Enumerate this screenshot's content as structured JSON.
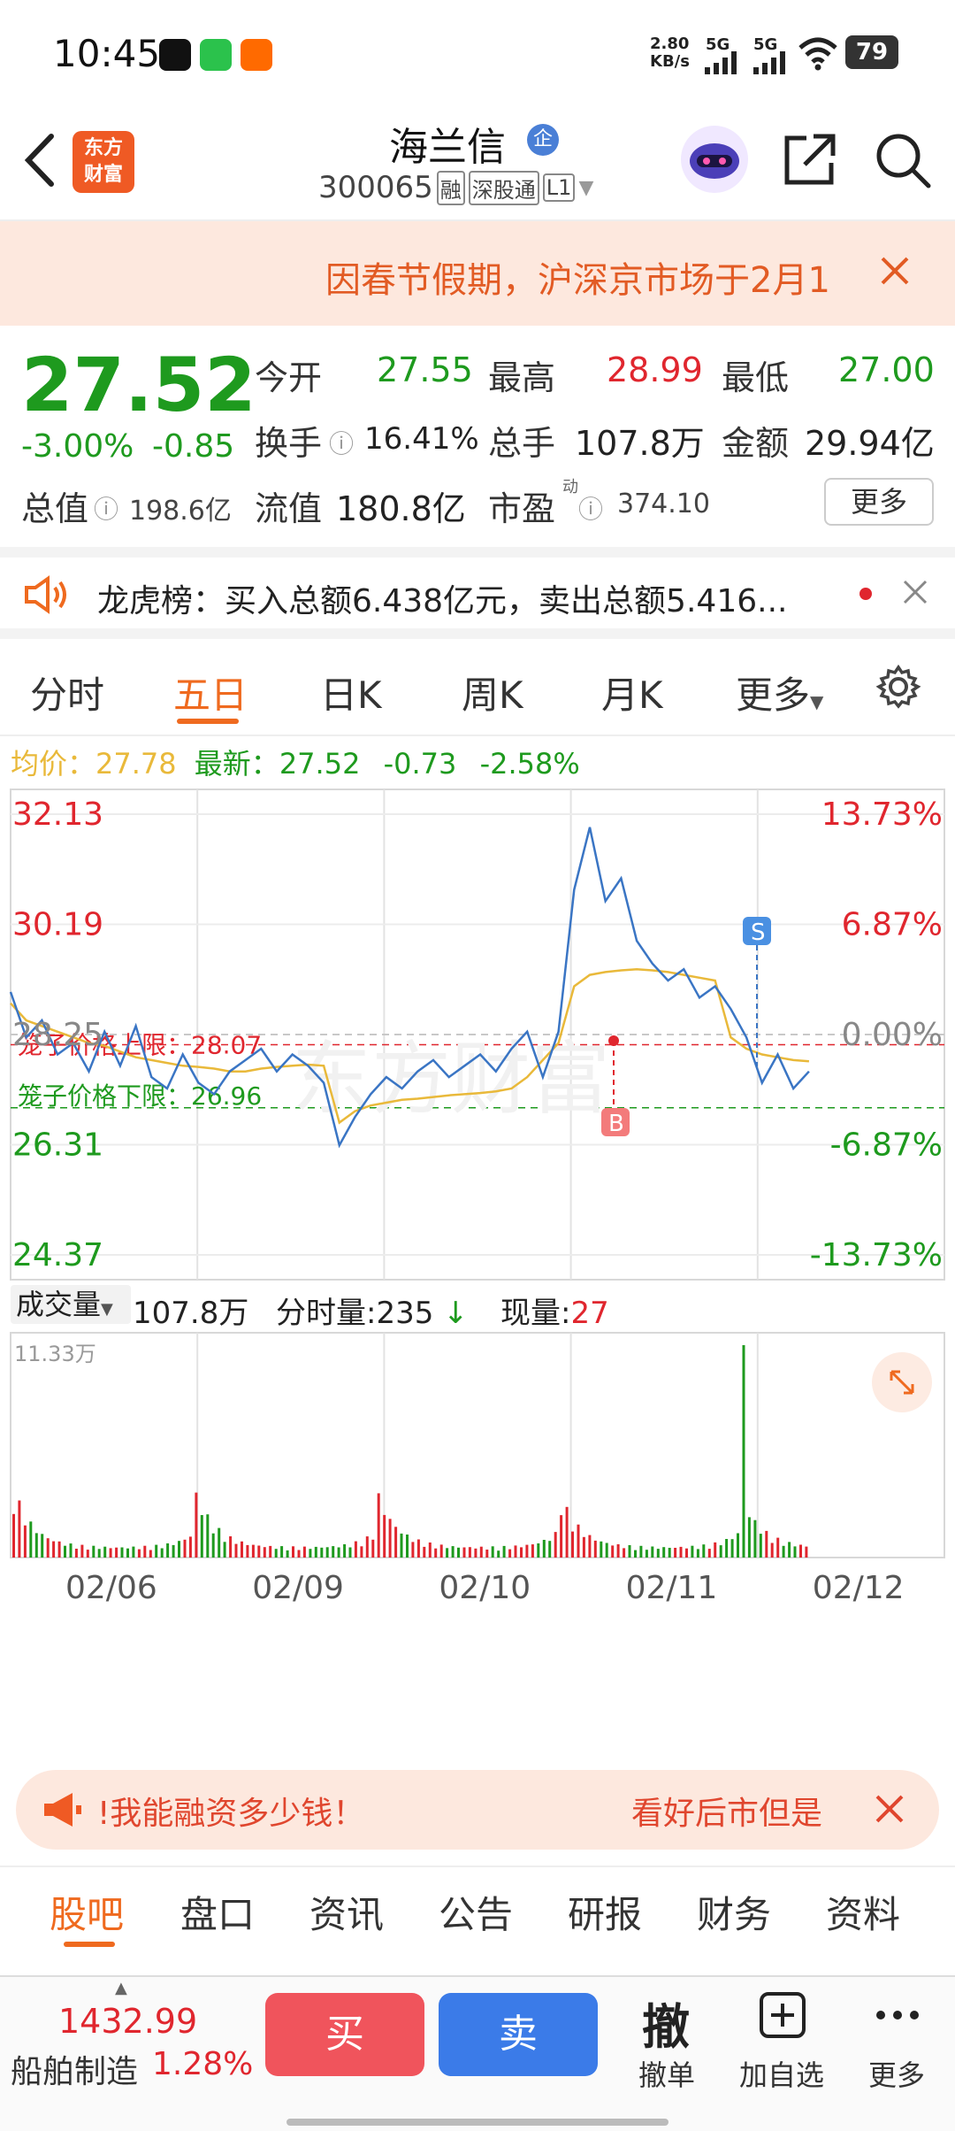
{
  "status_bar": {
    "time": "10:45",
    "net_speed": "2.80",
    "net_unit": "KB/s",
    "sig1": "5G",
    "sig2": "5G",
    "battery": "79"
  },
  "header": {
    "app_logo_line1": "东方",
    "app_logo_line2": "财富",
    "stock_name": "海兰信",
    "stock_badge": "企",
    "stock_code": "300065",
    "tag_margin": "融",
    "tag_connect": "深股通",
    "tag_level": "L1"
  },
  "notice": {
    "text": "因春节假期，沪深京市场于2月1"
  },
  "quote": {
    "price": "27.52",
    "change_pct": "-3.00%",
    "change_amt": "-0.85",
    "open_label": "今开",
    "open": "27.55",
    "high_label": "最高",
    "high": "28.99",
    "low_label": "最低",
    "low": "27.00",
    "turnover_label": "换手",
    "turnover": "16.41%",
    "volume_label": "总手",
    "volume": "107.8万",
    "amount_label": "金额",
    "amount": "29.94亿",
    "mktcap_label": "总值",
    "mktcap": "198.6亿",
    "float_label": "流值",
    "float": "180.8亿",
    "pe_label": "市盈",
    "pe_sup": "动",
    "pe": "374.10",
    "more_button": "更多"
  },
  "lhb": {
    "text": "龙虎榜：买入总额6.438亿元，卖出总额5.416..."
  },
  "chart_tabs": {
    "items": [
      "分时",
      "五日",
      "日K",
      "周K",
      "月K",
      "更多"
    ],
    "active": "五日"
  },
  "chart": {
    "avg_label": "均价：",
    "avg_value": "27.78",
    "latest_label": "最新：",
    "latest_value": "27.52",
    "latest_chg": "-0.73",
    "latest_pct": "-2.58%",
    "cage_upper": "笼子价格上限：28.07",
    "cage_lower": "笼子价格下限：26.96",
    "watermark": "东方财富",
    "marker_s": "S",
    "marker_b": "B",
    "vol_selector": "成交量",
    "vol_total": "107.8万",
    "vol_tick_label": "分时量:235",
    "vol_now_label": "现量:",
    "vol_now": "27",
    "vol_max": "11.33万",
    "colors": {
      "price_line": "#3a75c4",
      "avg_line": "#e9b93a",
      "up": "#e0262e",
      "down": "#1e9a1e"
    }
  },
  "chart_data": {
    "type": "line",
    "x_labels": [
      "02/06",
      "02/09",
      "02/10",
      "02/11",
      "02/12"
    ],
    "y_left_ticks": [
      "32.13",
      "30.19",
      "28.25",
      "26.31",
      "24.37"
    ],
    "y_right_ticks": [
      "13.73%",
      "6.87%",
      "0.00%",
      "-6.87%",
      "-13.73%"
    ],
    "ylim": [
      24.37,
      32.13
    ],
    "series": [
      {
        "values": [
          29.0,
          28.2,
          28.5,
          27.9,
          28.1,
          27.6,
          28.3,
          27.7,
          28.4,
          27.5,
          27.3,
          27.9,
          27.4,
          27.2,
          27.6,
          27.8,
          28.0,
          27.6,
          27.9,
          27.7,
          27.4,
          26.3,
          26.8,
          27.2,
          27.5,
          27.3,
          27.6,
          27.8,
          27.5,
          27.7,
          27.9,
          27.6,
          28.0,
          28.3,
          27.5,
          28.3,
          30.8,
          31.9,
          30.6,
          31.0,
          29.9,
          29.5,
          29.2,
          29.4,
          28.9,
          29.1,
          28.7,
          28.2,
          27.4,
          27.9,
          27.3,
          27.6
        ]
      },
      {
        "values": [
          28.8,
          28.5,
          28.4,
          28.3,
          28.2,
          28.1,
          28.05,
          27.95,
          27.85,
          27.8,
          27.75,
          27.7,
          27.68,
          27.65,
          27.6,
          27.6,
          27.65,
          27.68,
          27.7,
          27.72,
          27.7,
          26.7,
          26.9,
          27.0,
          27.05,
          27.1,
          27.12,
          27.15,
          27.18,
          27.2,
          27.22,
          27.25,
          27.3,
          27.5,
          27.8,
          28.1,
          29.1,
          29.3,
          29.35,
          29.38,
          29.4,
          29.38,
          29.35,
          29.3,
          29.25,
          29.2,
          28.2,
          28.0,
          27.9,
          27.85,
          27.8,
          27.78
        ]
      }
    ],
    "volume": {
      "ymax": "11.33万"
    }
  },
  "banner": {
    "left_text": "!我能融资多少钱！",
    "right_text": "看好后市但是"
  },
  "sub_tabs": {
    "items": [
      "股吧",
      "盘口",
      "资讯",
      "公告",
      "研报",
      "财务",
      "资料"
    ],
    "active": "股吧"
  },
  "bottom_bar": {
    "index_value": "1432.99",
    "index_name": "船舶制造",
    "index_pct": "1.28%",
    "buy": "买",
    "sell": "卖",
    "cancel_big": "撤",
    "cancel_label": "撤单",
    "add_fav": "加自选",
    "more": "更多"
  }
}
